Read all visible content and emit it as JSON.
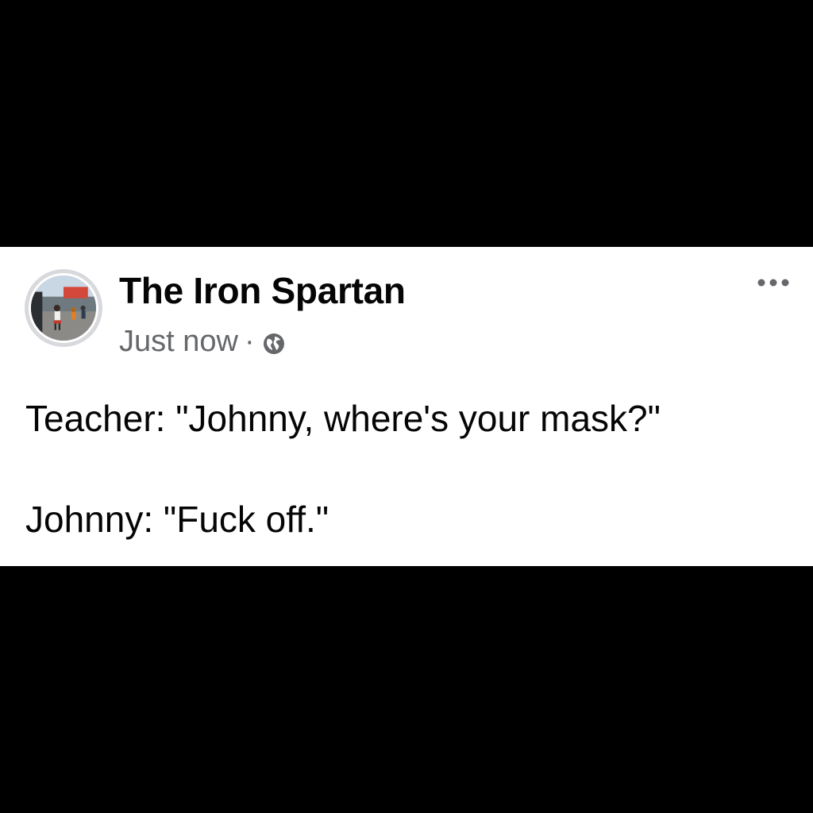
{
  "post": {
    "author": "The Iron Spartan",
    "timestamp": "Just now",
    "separator": "·",
    "audience_icon": "globe-icon",
    "more_icon": "more-options-icon",
    "lines": [
      "Teacher: \"Johnny, where's your mask?\"",
      "Johnny: \"Fuck off.\""
    ]
  },
  "colors": {
    "background": "#000000",
    "card": "#ffffff",
    "primary_text": "#050505",
    "secondary_text": "#65676b"
  }
}
